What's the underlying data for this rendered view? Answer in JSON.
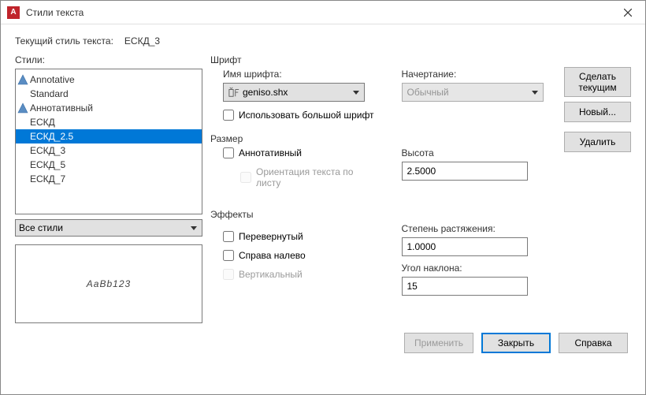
{
  "title": "Стили текста",
  "current_label": "Текущий стиль текста:",
  "current_value": "ЕСКД_3",
  "styles_label": "Стили:",
  "styles": {
    "items": [
      "Annotative",
      "Standard",
      "Аннотативный",
      "ЕСКД",
      "ЕСКД_2.5",
      "ЕСКД_3",
      "ЕСКД_5",
      "ЕСКД_7"
    ],
    "annotative_flags": [
      true,
      false,
      true,
      false,
      false,
      false,
      false,
      false
    ],
    "selected_index": 4
  },
  "filter_value": "Все стили",
  "preview_text": "AaBb123",
  "font": {
    "section": "Шрифт",
    "name_label": "Имя шрифта:",
    "name_value": "geniso.shx",
    "style_label": "Начертание:",
    "style_value": "Обычный",
    "bigfont_label": "Использовать большой шрифт"
  },
  "size": {
    "section": "Размер",
    "annotative_label": "Аннотативный",
    "match_label": "Ориентация текста по листу",
    "height_label": "Высота",
    "height_value": "2.5000"
  },
  "effects": {
    "section": "Эффекты",
    "upside_label": "Перевернутый",
    "backwards_label": "Справа налево",
    "vertical_label": "Вертикальный",
    "width_label": "Степень растяжения:",
    "width_value": "1.0000",
    "oblique_label": "Угол наклона:",
    "oblique_value": "15"
  },
  "buttons": {
    "set_current": "Сделать текущим",
    "new": "Новый...",
    "delete": "Удалить",
    "apply": "Применить",
    "close": "Закрыть",
    "help": "Справка"
  }
}
